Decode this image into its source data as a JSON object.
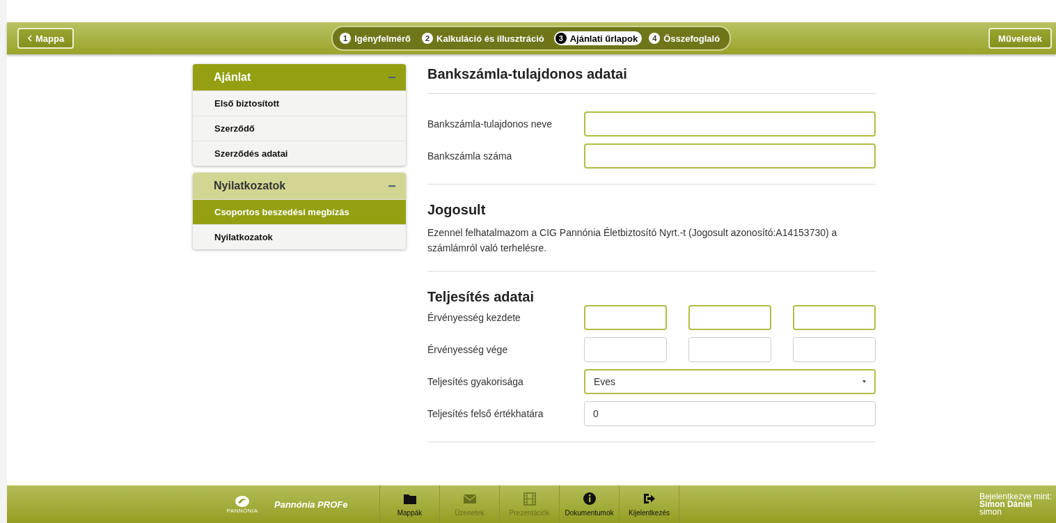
{
  "header": {
    "back_button": "Mappa",
    "steps": [
      {
        "number": "1",
        "label": "Igényfelmérő",
        "selected": false
      },
      {
        "number": "2",
        "label": "Kalkuláció és illusztráció",
        "selected": false
      },
      {
        "number": "3",
        "label": "Ajánlati űrlapok",
        "selected": true
      },
      {
        "number": "4",
        "label": "Összefoglaló",
        "selected": false
      }
    ],
    "actions_button": "Műveletek"
  },
  "sidebar": {
    "groups": [
      {
        "title": "Ajánlat",
        "active": true,
        "collapse_icon": "−",
        "items": [
          {
            "label": "Első biztosított",
            "selected": false
          },
          {
            "label": "Szerződő",
            "selected": false
          },
          {
            "label": "Szerződés adatai",
            "selected": false
          }
        ]
      },
      {
        "title": "Nyilatkozatok",
        "active": false,
        "collapse_icon": "−",
        "items": [
          {
            "label": "Csoportos beszedési megbízás",
            "selected": true
          },
          {
            "label": "Nyilatkozatok",
            "selected": false
          }
        ]
      }
    ]
  },
  "sections": [
    {
      "heading": "Bankszámla-tulajdonos adatai",
      "fields": [
        {
          "kind": "text",
          "label": "Bankszámla-tulajdonos neve",
          "required": true
        },
        {
          "kind": "text",
          "label": "Bankszámla száma",
          "required": true
        }
      ]
    },
    {
      "heading": "Jogosult",
      "paragraph": "Ezennel felhatalmazom a CIG Pannónia Életbiztosító Nyrt.-t (Jogosult azonosító:A14153730) a számlámról való terhelésre."
    },
    {
      "heading": "Teljesítés adatai",
      "fields": [
        {
          "kind": "date",
          "label": "Érvényesség kezdete",
          "required": true
        },
        {
          "kind": "date",
          "label": "Érvényesség vége",
          "required": false
        },
        {
          "kind": "select",
          "label": "Teljesítés gyakorisága",
          "value": "Eves",
          "required": true
        },
        {
          "kind": "text",
          "label": "Teljesítés felső értékhatára",
          "value": "0",
          "required": false
        }
      ]
    }
  ],
  "footer": {
    "logo_text": "PANNÓNIA",
    "app_name": "Pannónia PROFe",
    "nav": [
      {
        "kind": "folder",
        "label": "Mappák",
        "disabled": false
      },
      {
        "kind": "envelope",
        "label": "Üzenetek",
        "disabled": true
      },
      {
        "kind": "film",
        "label": "Prezentációk",
        "disabled": true
      },
      {
        "kind": "info",
        "label": "Dokumentumok",
        "disabled": false
      },
      {
        "kind": "logout",
        "label": "Kijelentkezés",
        "disabled": false
      }
    ],
    "login_caption": "Bejelentkezve mint:",
    "user_name": "Simon Dániel",
    "user_login": "simon"
  }
}
